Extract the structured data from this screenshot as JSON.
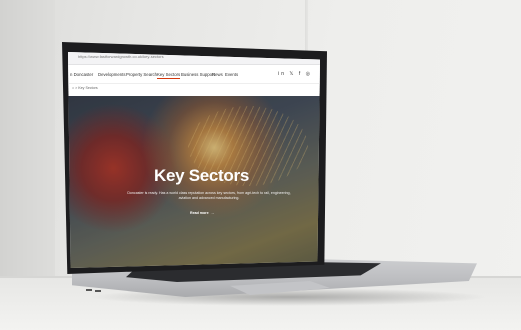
{
  "browser": {
    "url": "https://www.fastforwardgrowth.co.uk/key-sectors",
    "controls": "⋯ ☆ ⋮"
  },
  "site": {
    "brand": "n Doncaster",
    "nav": [
      "Developments",
      "Property Search",
      "Key Sectors",
      "Business Support",
      "News",
      "Events"
    ],
    "social": "in  𝕏  f  ◎",
    "breadcrumb": "⌂  >  Key Sectors"
  },
  "hero": {
    "title": "Key Sectors",
    "description": "Doncaster is ready. Has a world class reputation across key sectors, from agri-tech to rail, engineering, aviation and advanced manufacturing.",
    "link_label": "Read more",
    "link_arrow": "→"
  },
  "colors": {
    "accent": "#d4380d"
  }
}
